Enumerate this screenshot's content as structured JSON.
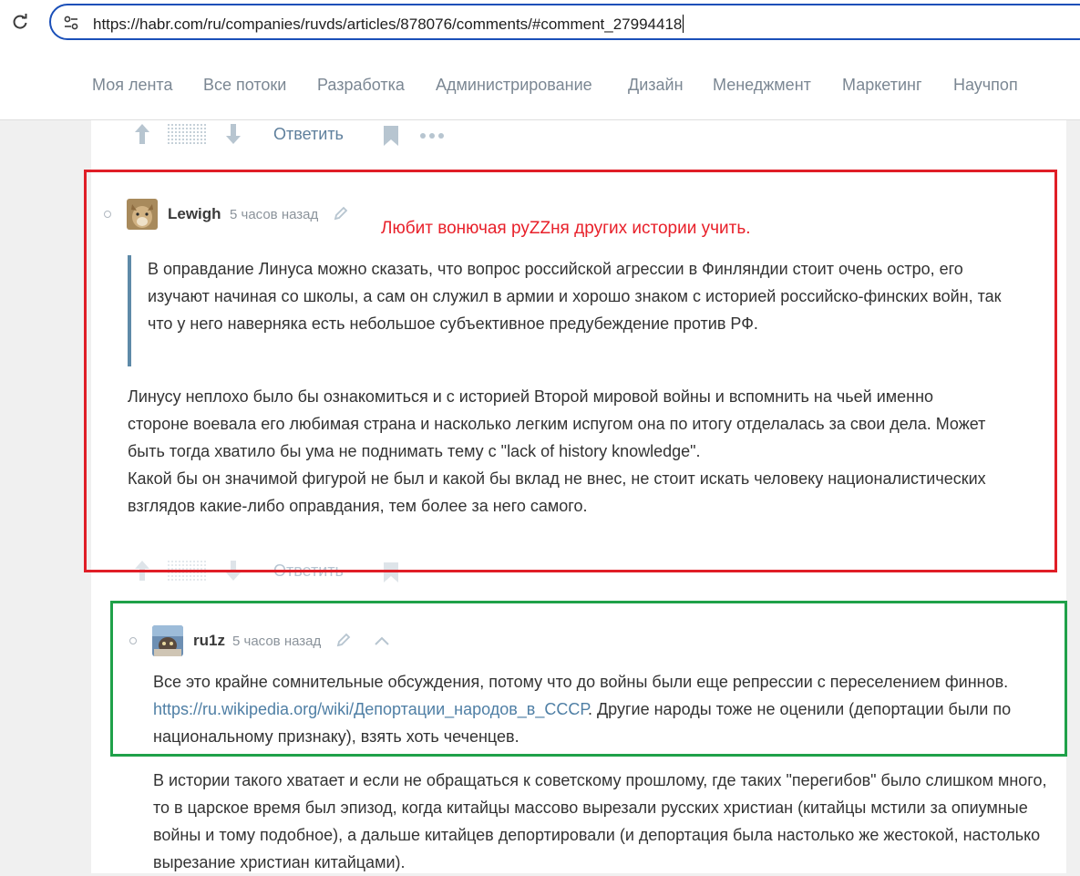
{
  "browser": {
    "url": "https://habr.com/ru/companies/ruvds/articles/878076/comments/#comment_27994418"
  },
  "nav": {
    "items": [
      "Моя лента",
      "Все потоки",
      "Разработка",
      "Администрирование",
      "Дизайн",
      "Менеджмент",
      "Маркетинг",
      "Научпоп"
    ]
  },
  "actions": {
    "reply_label": "Ответить"
  },
  "annotation": {
    "text": "Любит вонючая руZZня других истории учить."
  },
  "comments": [
    {
      "username": "Lewigh",
      "time": "5 часов назад",
      "quote": "В оправдание Линуса можно сказать, что вопрос российской агрессии в Финляндии стоит очень остро, его изучают начиная со школы, а сам он служил в армии и хорошо знаком с историей российско-финских войн, так что у него наверняка есть небольшое субъективное предубеждение против РФ.",
      "body_1": "Линусу неплохо было бы ознакомиться и с историей Второй мировой войны и вспомнить на чьей именно стороне воевала его любимая страна и насколько легким испугом она по итогу отделалась за свои дела. Может быть тогда хватило бы ума не поднимать тему с \"lack of history knowledge\".",
      "body_2": "Какой бы он значимой фигурой не был и какой бы вклад не внес, не стоит искать человеку националистических взглядов какие-либо оправдания, тем более за него самого."
    },
    {
      "username": "ru1z",
      "time": "5 часов назад",
      "body_pre": "Все это крайне сомнительные обсуждения, потому что до войны были еще репрессии с переселением финнов. ",
      "link": "https://ru.wikipedia.org/wiki/Депортации_народов_в_СССР",
      "body_post": ". Другие народы тоже не оценили (депортации были по национальному признаку), взять хоть чеченцев.",
      "body_2": "В истории такого хватает и если не обращаться к советскому прошлому, где таких \"перегибов\" было слишком много, то в царское время был эпизод, когда китайцы массово вырезали русских христиан (китайцы мстили за опиумные войны и тому подобное), а дальше китайцев депортировали (и депортация была настолько же жестокой, настолько вырезание христиан китайцами)."
    }
  ],
  "colors": {
    "accent": "#5e7f9c",
    "red_annotation": "#e01e27",
    "green_annotation": "#1fa149"
  }
}
